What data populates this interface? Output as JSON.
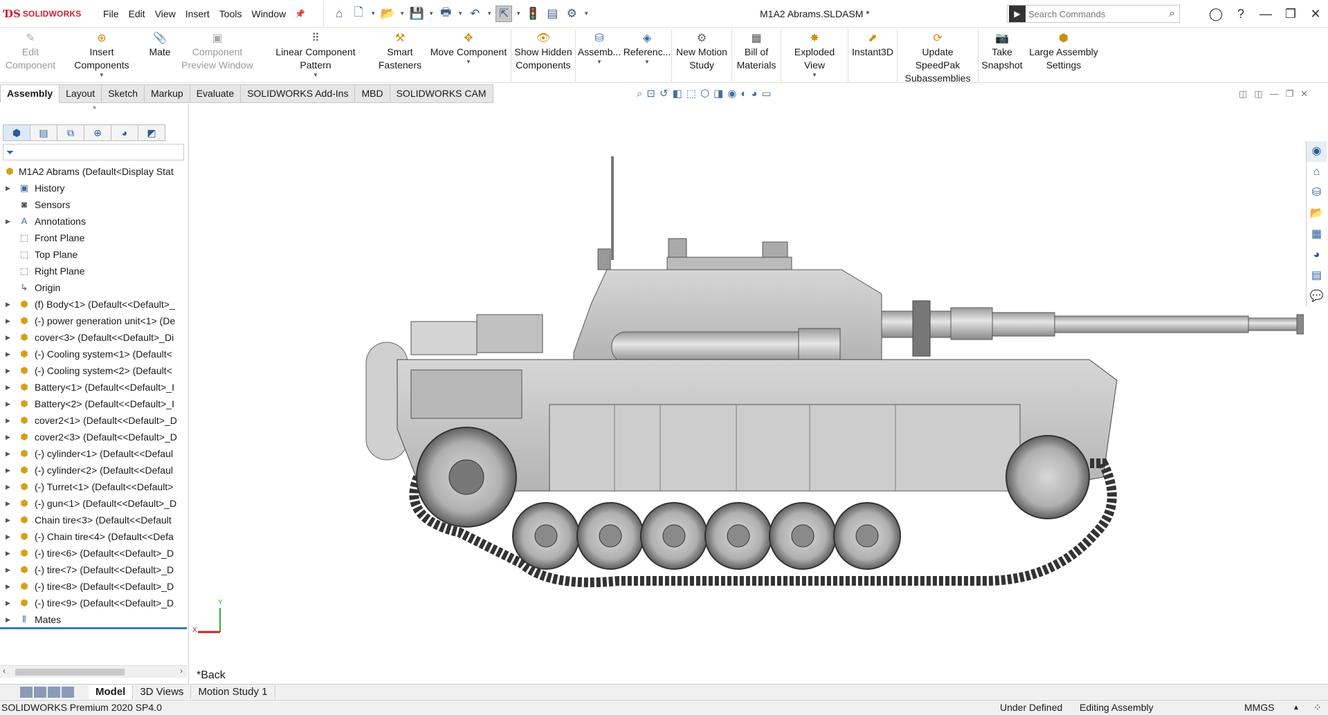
{
  "app": {
    "brand": "SOLIDWORKS",
    "menus": [
      "File",
      "Edit",
      "View",
      "Insert",
      "Tools",
      "Window"
    ],
    "document_title": "M1A2 Abrams.SLDASM *",
    "search_placeholder": "Search Commands"
  },
  "commands": [
    {
      "label": "Edit\nComponent",
      "icon": "edit-component-icon",
      "enabled": false
    },
    {
      "label": "Insert Components",
      "icon": "insert-components-icon",
      "enabled": true
    },
    {
      "label": "Mate",
      "icon": "mate-icon",
      "enabled": true
    },
    {
      "label": "Component\nPreview Window",
      "icon": "component-preview-icon",
      "enabled": false
    },
    {
      "label": "Linear Component Pattern",
      "icon": "linear-pattern-icon",
      "enabled": true
    },
    {
      "label": "Smart\nFasteners",
      "icon": "smart-fasteners-icon",
      "enabled": true
    },
    {
      "label": "Move Component",
      "icon": "move-component-icon",
      "enabled": true
    },
    {
      "label": "Show Hidden\nComponents",
      "icon": "show-hidden-icon",
      "enabled": true
    },
    {
      "label": "Assemb...",
      "icon": "assembly-features-icon",
      "enabled": true
    },
    {
      "label": "Referenc...",
      "icon": "reference-geometry-icon",
      "enabled": true
    },
    {
      "label": "New Motion\nStudy",
      "icon": "motion-study-icon",
      "enabled": true
    },
    {
      "label": "Bill of\nMaterials",
      "icon": "bom-icon",
      "enabled": true
    },
    {
      "label": "Exploded View",
      "icon": "exploded-view-icon",
      "enabled": true
    },
    {
      "label": "Instant3D",
      "icon": "instant3d-icon",
      "enabled": true
    },
    {
      "label": "Update SpeedPak\nSubassemblies",
      "icon": "speedpak-icon",
      "enabled": true
    },
    {
      "label": "Take\nSnapshot",
      "icon": "snapshot-icon",
      "enabled": true
    },
    {
      "label": "Large Assembly\nSettings",
      "icon": "large-assembly-icon",
      "enabled": true
    }
  ],
  "tabs": [
    "Assembly",
    "Layout",
    "Sketch",
    "Markup",
    "Evaluate",
    "SOLIDWORKS Add-Ins",
    "MBD",
    "SOLIDWORKS CAM"
  ],
  "active_tab": "Assembly",
  "tree": {
    "root": "M1A2 Abrams  (Default<Display Stat",
    "items": [
      {
        "label": "History",
        "type": "folder",
        "expandable": true
      },
      {
        "label": "Sensors",
        "type": "folder",
        "expandable": false
      },
      {
        "label": "Annotations",
        "type": "folder",
        "expandable": true
      },
      {
        "label": "Front Plane",
        "type": "plane",
        "expandable": false
      },
      {
        "label": "Top Plane",
        "type": "plane",
        "expandable": false
      },
      {
        "label": "Right Plane",
        "type": "plane",
        "expandable": false
      },
      {
        "label": "Origin",
        "type": "origin",
        "expandable": false
      },
      {
        "label": "(f) Body<1> (Default<<Default>_",
        "type": "component",
        "expandable": true
      },
      {
        "label": "(-) power generation unit<1> (De",
        "type": "component",
        "expandable": true
      },
      {
        "label": "cover<3> (Default<<Default>_Di",
        "type": "component",
        "expandable": true
      },
      {
        "label": "(-) Cooling system<1> (Default<",
        "type": "component",
        "expandable": true
      },
      {
        "label": "(-) Cooling system<2> (Default<",
        "type": "component",
        "expandable": true
      },
      {
        "label": "Battery<1> (Default<<Default>_I",
        "type": "component",
        "expandable": true
      },
      {
        "label": "Battery<2> (Default<<Default>_I",
        "type": "component",
        "expandable": true
      },
      {
        "label": "cover2<1> (Default<<Default>_D",
        "type": "component",
        "expandable": true
      },
      {
        "label": "cover2<3> (Default<<Default>_D",
        "type": "component",
        "expandable": true
      },
      {
        "label": "(-) cylinder<1> (Default<<Defaul",
        "type": "component",
        "expandable": true
      },
      {
        "label": "(-) cylinder<2> (Default<<Defaul",
        "type": "component",
        "expandable": true
      },
      {
        "label": "(-) Turret<1> (Default<<Default>",
        "type": "component",
        "expandable": true
      },
      {
        "label": "(-) gun<1> (Default<<Default>_D",
        "type": "component",
        "expandable": true
      },
      {
        "label": "Chain tire<3> (Default<<Default",
        "type": "component",
        "expandable": true
      },
      {
        "label": "(-) Chain tire<4> (Default<<Defa",
        "type": "component",
        "expandable": true
      },
      {
        "label": "(-) tire<6> (Default<<Default>_D",
        "type": "component",
        "expandable": true
      },
      {
        "label": "(-) tire<7> (Default<<Default>_D",
        "type": "component",
        "expandable": true
      },
      {
        "label": "(-) tire<8> (Default<<Default>_D",
        "type": "component",
        "expandable": true
      },
      {
        "label": "(-) tire<9> (Default<<Default>_D",
        "type": "component",
        "expandable": true
      },
      {
        "label": "Mates",
        "type": "mates",
        "expandable": true
      }
    ]
  },
  "viewport": {
    "view_label": "*Back",
    "triad_x": "X",
    "triad_y": "Y"
  },
  "bottom_tabs": [
    "Model",
    "3D Views",
    "Motion Study 1"
  ],
  "active_bottom_tab": "Model",
  "status": {
    "product": "SOLIDWORKS Premium 2020 SP4.0",
    "definition": "Under Defined",
    "mode": "Editing Assembly",
    "units": "MMGS"
  }
}
